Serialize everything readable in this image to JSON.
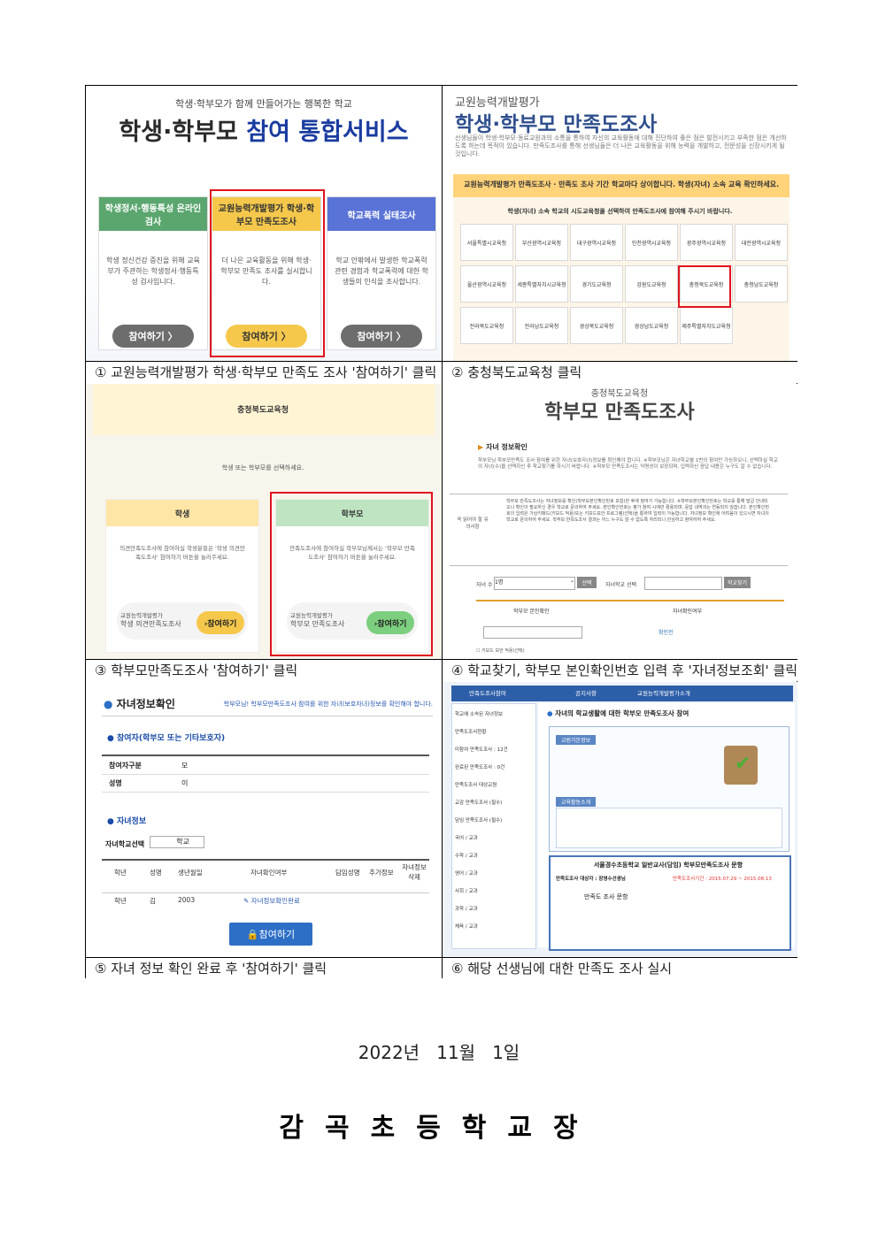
{
  "shot1": {
    "subtitle": "학생·학부모가 함께 만들어가는 행복한 학교",
    "title_a": "학생·학부모",
    "title_b": "참여 통합서비스",
    "cards": [
      {
        "header": "학생정서·행동특성 온라인 검사",
        "body": "학생 정신건강 증진을 위해 교육부가 주관하는 학생정서·행동특성 검사입니다.",
        "button": "참여하기 〉"
      },
      {
        "header": "교원능력개발평가 학생·학부모 만족도조사",
        "body": "더 나은 교육활동을 위해 학생·학부모 만족도 조사를 실시합니다.",
        "button": "참여하기 〉"
      },
      {
        "header": "학교폭력 실태조사",
        "body": "학교 안팎에서 발생한 학교폭력 관련 경험과 학교폭력에 대한 학생들의 인식을 조사합니다.",
        "button": "참여하기 〉"
      }
    ],
    "colors": {
      "green": "#5ba66f",
      "yellow": "#f5c84c",
      "blue": "#5a73d6",
      "gray": "#6d6d6d"
    }
  },
  "shot2": {
    "small_title": "교원능력개발평가",
    "big_title": "학생·학부모 만족도조사",
    "desc": "선생님들이 학생·학부모·동료교원과의 소통을 통하여 자신의 교육활동에 대해 진단하여 좋은 점은 발전시키고 부족한 점은 개선하도록 하는데 목적이 있습니다. 만족도조사를 통해 선생님들은 더 나은 교육활동을 위해 능력을 개발하고, 전문성을 신장시키게 될 것입니다.",
    "panel_header": "교원능력개발평가 만족도조사 · 만족도 조사 기간 학교마다 상이합니다. 학생(자녀) 소속 교육 확인하세요.",
    "instruction": "학생(자녀) 소속 학교의 시도교육청을 선택하여 만족도조사에 참여해 주시기 바랍니다.",
    "offices": [
      [
        "서울특별시교육청",
        "부산광역시교육청",
        "대구광역시교육청",
        "인천광역시교육청",
        "광주광역시교육청",
        "대전광역시교육청"
      ],
      [
        "울산광역시교육청",
        "세종특별자치시교육청",
        "경기도교육청",
        "강원도교육청",
        "충청북도교육청",
        "충청남도교육청"
      ],
      [
        "전라북도교육청",
        "전라남도교육청",
        "경상북도교육청",
        "경상남도교육청",
        "제주특별자치도교육청",
        ""
      ]
    ]
  },
  "shot3": {
    "header": "충청북도교육청",
    "prompt": "학생 또는 학부모를 선택하세요.",
    "cards": [
      {
        "header": "학생",
        "body": "의견만족도조사에 참여하실 학생분들은 '학생 의견만족도조사' 참여하기 버튼을 눌러주세요.",
        "foot_small": "교원능력개발평가",
        "foot_title": "학생 의견만족도조사",
        "button": "›참여하기"
      },
      {
        "header": "학부모",
        "body": "만족도조사에 참여하실 학부모님께서는 '학부모 만족도조사' 참여하기 버튼을 눌러주세요.",
        "foot_small": "교원능력개발평가",
        "foot_title": "학부모 만족도조사",
        "button": "›참여하기"
      }
    ]
  },
  "shot4": {
    "org": "충청북도교육청",
    "title": "학부모 만족도조사",
    "section": "자녀 정보확인",
    "intro": "학부모님 학부모만족도 조사 참여를 위한 자녀(보호자녀)정보를 확인해야 합니다. ※학부모님은 자녀학교별 1번의 참여만 가능하오니, 선택하실 학교의 자녀(수)을 선택하신 후 학교찾기를 하시기 바랍니다. ※학부모 만족도조사는 익명성이 보장되며, 입력하신 응답 내용은 누구도 알 수 없습니다.",
    "notice_label": "꼭 읽어야 할 유의사항",
    "notice": "학부모 만족도조사는 자녀정보를 확인(학부모본인확인번호 포함)한 후에 참여가 가능합니다. ※학부모본인확인번호는 학교를 통해 발급 안내되오니 확인이 필요하신 경우 학교로 문의하여 주세요. 본인확인번호는 평가 참여 시에만 활용되며, 응답 내역과는 연동되지 않습니다. 본인확인번호의 입력은 가상키패드(키보드 적용)또는 키보드보안 프로그램(선택)을 통하여 입력이 가능합니다. 자녀정보 확인에 어려움이 있으시면 자녀의 학교로 문의하여 주세요. 학부모 만족도조사 결과는 어느 누구도 알 수 없도록 처리되니 안심하고 참여하여 주세요.",
    "child_label": "자녀 수",
    "child_value": "1명",
    "select_btn": "선택",
    "school_label": "자녀학교 선택",
    "find_btn": "학교찾기",
    "col1": "학부모 본인확인",
    "col2": "자녀확인여부",
    "confirm": "확인전",
    "keyboard": "키보드 보안 적용(선택)"
  },
  "shot5": {
    "title": "자녀정보확인",
    "note": "학부모님! 학부모만족도조사 참여를 위한 자녀(보호자녀)정보를 확인해야 합니다.",
    "sub1": "참여자(학부모 또는 기타보호자)",
    "rows": [
      {
        "k": "참여자구분",
        "v": "모"
      },
      {
        "k": "성명",
        "v": "이"
      }
    ],
    "sub2": "자녀정보",
    "school_label": "자녀학교선택",
    "school_value": "학교",
    "headers": [
      "학년",
      "성명",
      "생년월일",
      "자녀확인여부",
      "담임성명",
      "추가정보",
      "자녀정보 삭제"
    ],
    "row": [
      "학년",
      "김",
      "2003",
      "자녀정보확인완료"
    ],
    "button": "참여하기"
  },
  "shot6": {
    "nav": [
      "만족도조사참여",
      "공지사항",
      "교원능력개발평가소개"
    ],
    "side": [
      "학교에 소속된 자녀정보",
      "만족도조사현황",
      "미참여 만족도조사 : 12건",
      "완료된 만족도조사 : 0건",
      "만족도조사 대상교원",
      "교감 만족도조사 (필수)",
      "담임 만족도조사 (필수)",
      "국어 / 교과",
      "수학 / 교과",
      "영어 / 교과",
      "사회 / 교과",
      "과학 / 교과",
      "체육 / 교과"
    ],
    "main_title": "자녀의 학교생활에 대한 학부모 만족도조사 참여",
    "box1": "교원기본정보",
    "box2": "교육활동소개",
    "table_title": "서울경수초등학교 일반교사(담임) 학부모만족도조사 문항",
    "table_sub": "만족도조사 대상자 : 장영수선생님",
    "period": "만족도조사기간 : 2015.07.29 ~ 2015.08.13",
    "col": "만족도 조사 문항"
  },
  "captions": [
    "① 교원능력개발평가 학생·학부모 만족도 조사 '참여하기' 클릭",
    "② 충청북도교육청 클릭",
    "③ 학부모만족도조사 '참여하기' 클릭",
    "④ 학교찾기, 학부모 본인확인번호 입력 후 '자녀정보조회' 클릭",
    "⑤ 자녀 정보 확인 완료 후 '참여하기' 클릭",
    "⑥ 해당 선생님에 대한 만족도 조사 실시"
  ],
  "date": "2022년   11월   1일",
  "signature": "감곡초등학교장"
}
